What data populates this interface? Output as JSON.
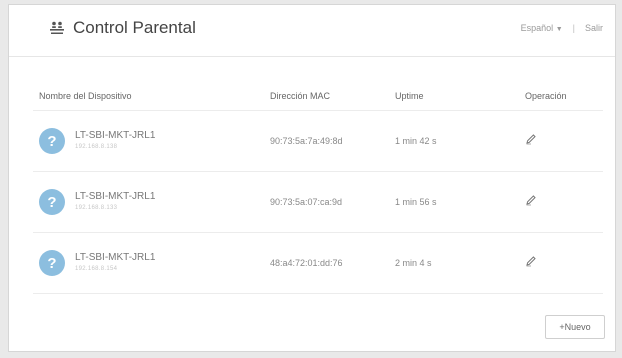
{
  "header": {
    "title": "Control Parental",
    "language": "Español",
    "separator": "|",
    "logout": "Salir"
  },
  "table": {
    "columns": [
      "Nombre del Dispositivo",
      "Dirección MAC",
      "Uptime",
      "Operación"
    ],
    "rows": [
      {
        "name": "LT-SBI-MKT-JRL1",
        "ip": "192.168.8.138",
        "mac": "90:73:5a:7a:49:8d",
        "uptime": "1 min 42 s"
      },
      {
        "name": "LT-SBI-MKT-JRL1",
        "ip": "192.168.8.133",
        "mac": "90:73:5a:07:ca:9d",
        "uptime": "1 min 56 s"
      },
      {
        "name": "LT-SBI-MKT-JRL1",
        "ip": "192.168.8.154",
        "mac": "48:a4:72:01:dd:76",
        "uptime": "2 min 4 s"
      }
    ]
  },
  "device_icon_glyph": "?",
  "icons": {
    "title": "parental-control-icon",
    "edit": "edit-pencil-icon",
    "device": "unknown-device-icon",
    "language_dropdown": "chevron-down-icon"
  },
  "colors": {
    "avatar": "#8cbedf",
    "background": "#e9e9e9",
    "panel": "#ffffff"
  },
  "actions": {
    "new_label": "+Nuevo"
  }
}
